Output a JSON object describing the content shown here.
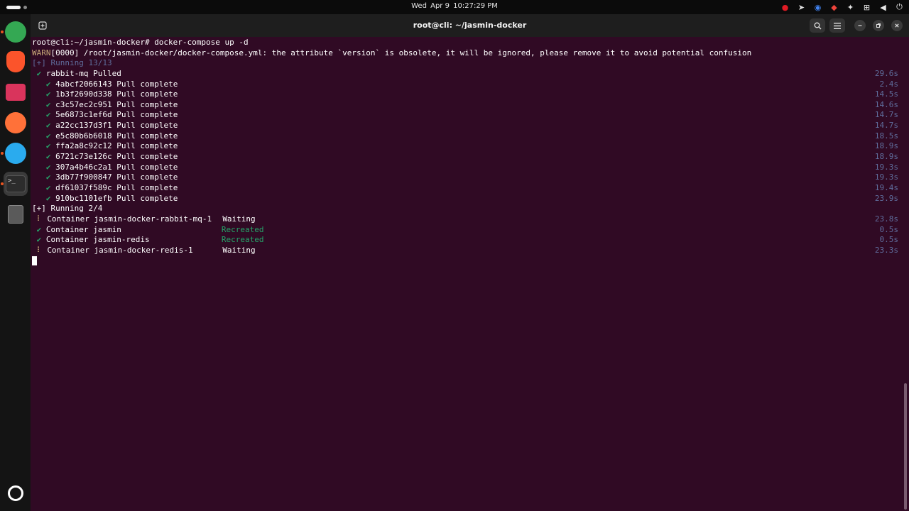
{
  "topbar": {
    "day": "Wed",
    "date": "Apr 9",
    "time": "10:27:29 PM"
  },
  "tray": [
    {
      "icon": "screen-record-icon",
      "glyph": "●",
      "color": "#e01b24"
    },
    {
      "icon": "telegram-tray-icon",
      "glyph": "➤",
      "color": "#e6e6e6"
    },
    {
      "icon": "chrome-tray-icon",
      "glyph": "◉",
      "color": "#4285f4"
    },
    {
      "icon": "anydesk-tray-icon",
      "glyph": "◆",
      "color": "#ef443b"
    },
    {
      "icon": "accessibility-icon",
      "glyph": "✦",
      "color": "#e6e6e6"
    },
    {
      "icon": "network-icon",
      "glyph": "⊞",
      "color": "#e6e6e6"
    },
    {
      "icon": "volume-icon",
      "glyph": "◀",
      "color": "#e6e6e6"
    },
    {
      "icon": "power-icon",
      "glyph": "⏻",
      "color": "#e6e6e6"
    }
  ],
  "dock": [
    {
      "name": "chrome",
      "icon": "chrome-icon",
      "color": "#34a853"
    },
    {
      "name": "brave",
      "icon": "brave-icon",
      "color": "#fb542b"
    },
    {
      "name": "files",
      "icon": "files-icon",
      "color": "#d9345c"
    },
    {
      "name": "firefox",
      "icon": "firefox-icon",
      "color": "#ff7139"
    },
    {
      "name": "telegram",
      "icon": "telegram-icon",
      "color": "#2aabee"
    },
    {
      "name": "terminal",
      "icon": "terminal-icon",
      "color": "#2c2c2c"
    },
    {
      "name": "trash",
      "icon": "trash-icon",
      "color": "#5a5a5a"
    },
    {
      "name": "show-apps",
      "icon": "ubuntu-logo-icon",
      "color": "#ffffff"
    }
  ],
  "window": {
    "title": "root@cli: ~/jasmin-docker"
  },
  "terminal": {
    "prompt": "root@cli:~/jasmin-docker# ",
    "command": "docker-compose up -d",
    "warn_tag": "WARN",
    "warn_text": "[0000] /root/jasmin-docker/docker-compose.yml: the attribute `version` is obsolete, it will be ignored, please remove it to avoid potential confusion",
    "running1": "[+] Running 13/13",
    "pulled": {
      "name": "rabbit-mq Pulled",
      "time": "29.6s"
    },
    "layers": [
      {
        "id": "4abcf2066143",
        "status": "Pull complete",
        "time": "2.4s"
      },
      {
        "id": "1b3f2690d338",
        "status": "Pull complete",
        "time": "14.5s"
      },
      {
        "id": "c3c57ec2c951",
        "status": "Pull complete",
        "time": "14.6s"
      },
      {
        "id": "5e6873c1ef6d",
        "status": "Pull complete",
        "time": "14.7s"
      },
      {
        "id": "a22cc137d3f1",
        "status": "Pull complete",
        "time": "14.7s"
      },
      {
        "id": "e5c80b6b6018",
        "status": "Pull complete",
        "time": "18.5s"
      },
      {
        "id": "ffa2a8c92c12",
        "status": "Pull complete",
        "time": "18.9s"
      },
      {
        "id": "6721c73e126c",
        "status": "Pull complete",
        "time": "18.9s"
      },
      {
        "id": "307a4b46c2a1",
        "status": "Pull complete",
        "time": "19.3s"
      },
      {
        "id": "3db77f900847",
        "status": "Pull complete",
        "time": "19.3s"
      },
      {
        "id": "df61037f589c",
        "status": "Pull complete",
        "time": "19.4s"
      },
      {
        "id": "910bc1101efb",
        "status": "Pull complete",
        "time": "23.9s"
      }
    ],
    "running2": "[+] Running 2/4",
    "containers": [
      {
        "mark": "⠇",
        "name": "Container jasmin-docker-rabbit-mq-1",
        "status": "Waiting",
        "state": "waiting",
        "time": "23.8s"
      },
      {
        "mark": "✔",
        "name": "Container jasmin",
        "status": "Recreated",
        "state": "ok",
        "time": "0.5s"
      },
      {
        "mark": "✔",
        "name": "Container jasmin-redis",
        "status": "Recreated",
        "state": "ok",
        "time": "0.5s"
      },
      {
        "mark": "⠇",
        "name": "Container jasmin-docker-redis-1",
        "status": "Waiting",
        "state": "waiting",
        "time": "23.3s"
      }
    ],
    "check": "✔"
  }
}
